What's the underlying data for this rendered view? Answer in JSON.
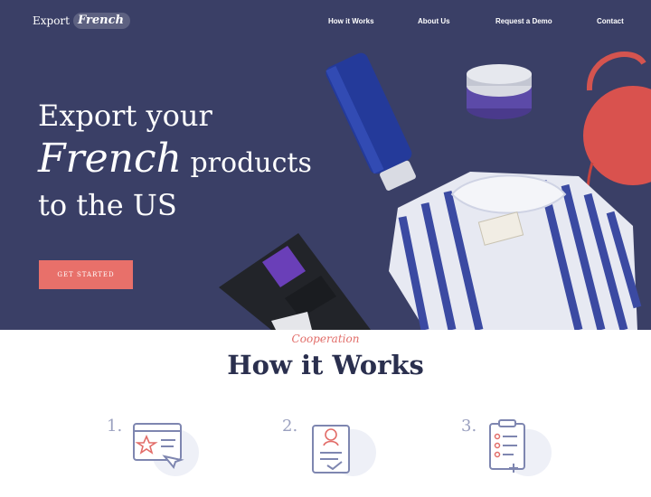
{
  "brand": {
    "name_prefix": "Export",
    "name_highlight": "French"
  },
  "nav": {
    "items": [
      "How it Works",
      "About Us",
      "Request a Demo",
      "Contact"
    ]
  },
  "hero": {
    "line1": "Export your",
    "line2_big": "French",
    "line2_rest": " products",
    "line3": "to the US",
    "cta_label": "GET STARTED"
  },
  "section": {
    "eyebrow": "Cooperation",
    "title": "How it Works"
  },
  "steps": [
    {
      "number": "1."
    },
    {
      "number": "2."
    },
    {
      "number": "3."
    }
  ],
  "colors": {
    "hero_bg": "#3a3f66",
    "accent": "#e8706a",
    "heading": "#2a2f4e"
  }
}
